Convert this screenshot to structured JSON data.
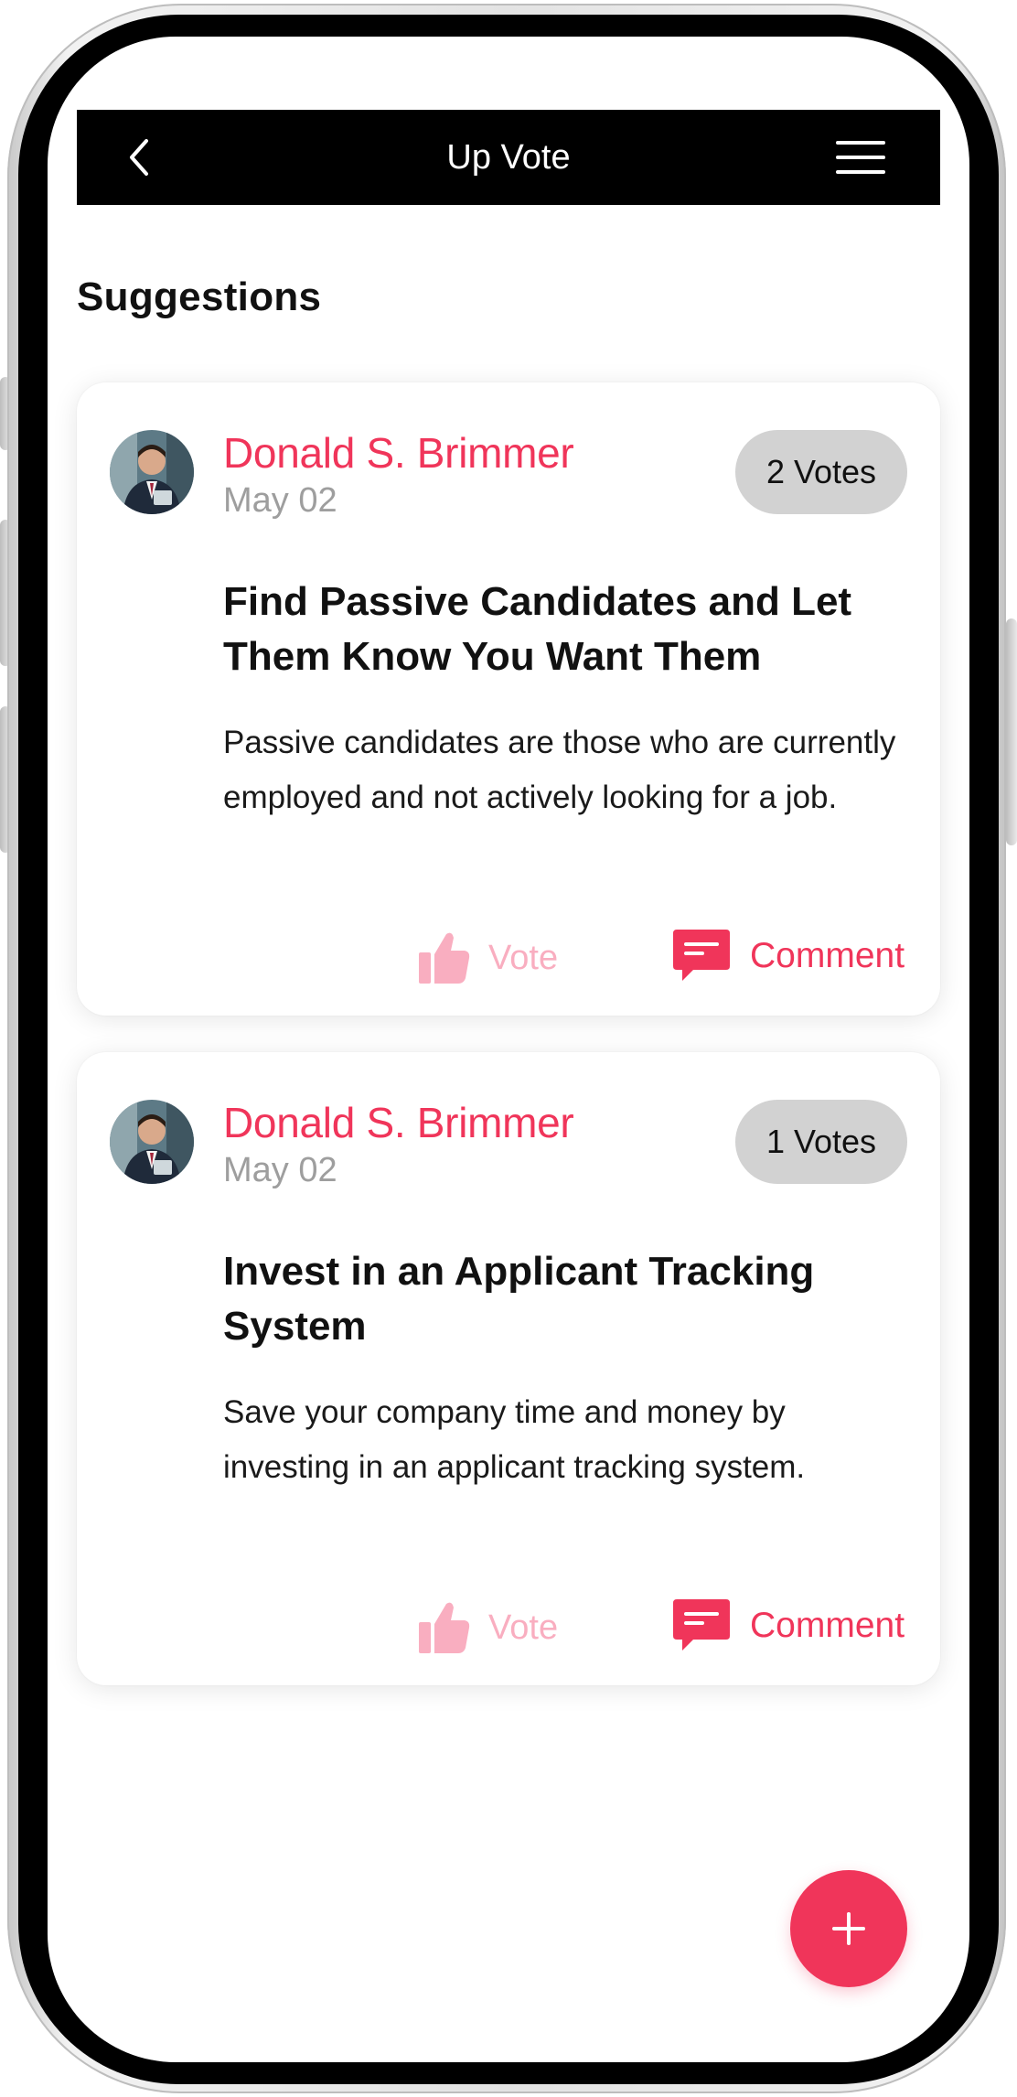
{
  "header": {
    "title": "Up Vote",
    "back_icon": "chevron-left-icon",
    "menu_icon": "hamburger-menu-icon"
  },
  "section_title": "Suggestions",
  "suggestions": [
    {
      "author": "Donald S. Brimmer",
      "date": "May 02",
      "votes": "2 Votes",
      "title": "Find Passive Candidates and Let Them Know You Want Them",
      "description": "Passive candidates are those who are currently employed and not actively looking for a job.",
      "vote_label": "Vote",
      "comment_label": "Comment"
    },
    {
      "author": "Donald S. Brimmer",
      "date": "May 02",
      "votes": "1 Votes",
      "title": "Invest in an Applicant Tracking System",
      "description": "Save your company time and money by investing in an applicant tracking system.",
      "vote_label": "Vote",
      "comment_label": "Comment"
    }
  ],
  "fab": {
    "icon": "plus-icon"
  },
  "colors": {
    "accent": "#f0355a",
    "accent_light": "#f9aec0",
    "badge_bg": "#d2d2d2",
    "header_bg": "#000000",
    "date_text": "#9e9e9e"
  }
}
